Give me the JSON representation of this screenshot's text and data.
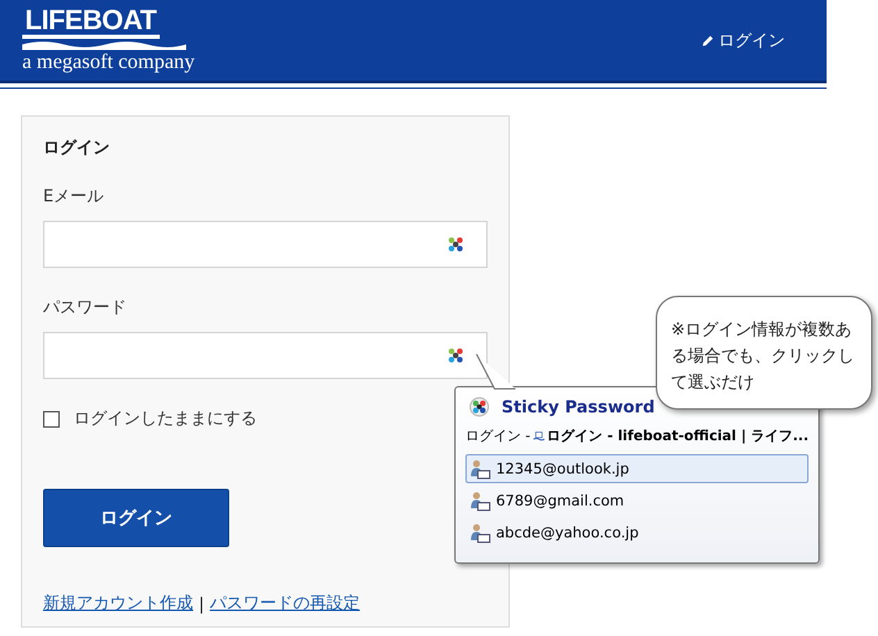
{
  "header": {
    "logo": "LIFEBOAT",
    "tagline": "a megasoft company",
    "login_link": "ログイン"
  },
  "form": {
    "title": "ログイン",
    "email_label": "Eメール",
    "password_label": "パスワード",
    "remember": {
      "label": "ログインしたままにする",
      "checked": false
    },
    "submit": "ログイン",
    "links": [
      "新規アカウント作成",
      "パスワードの再設定"
    ],
    "separator": "|"
  },
  "popup": {
    "title": "Sticky Password",
    "site_prefix": "ログイン -",
    "site_title": "ログイン - lifeboat-official | ライフ...",
    "accounts": [
      {
        "label": "12345@outlook.jp",
        "selected": true
      },
      {
        "label": "6789@gmail.com",
        "selected": false
      },
      {
        "label": "abcde@yahoo.co.jp",
        "selected": false
      }
    ]
  },
  "annotation": "※ログイン情報が複数ある場合でも、クリックして選ぶだけ"
}
